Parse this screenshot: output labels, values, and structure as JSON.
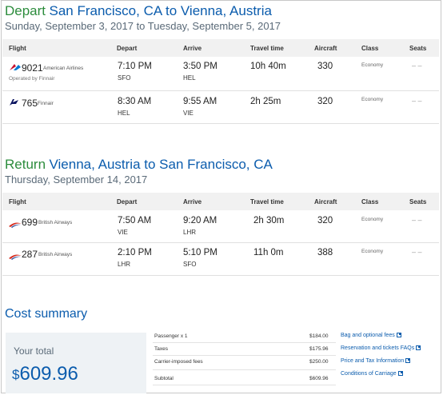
{
  "outbound": {
    "keyword": "Depart",
    "route": "San Francisco, CA to Vienna, Austria",
    "date_start": "Sunday, September 3, 2017",
    "date_mid": "to",
    "date_end": "Tuesday, September 5, 2017",
    "flights": [
      {
        "number": "9021",
        "carrier": "American Airlines",
        "operated_by": "Operated by Finnair",
        "depart_time": "7:10 PM",
        "depart_airport": "SFO",
        "arrive_time": "3:50 PM",
        "arrive_airport": "HEL",
        "travel_time": "10h 40m",
        "aircraft": "330",
        "class": "Economy",
        "seats": "– –",
        "logo_icon": "american-airlines-logo"
      },
      {
        "number": "765",
        "carrier": "Finnair",
        "operated_by": "",
        "depart_time": "8:30 AM",
        "depart_airport": "HEL",
        "arrive_time": "9:55 AM",
        "arrive_airport": "VIE",
        "travel_time": "2h 25m",
        "aircraft": "320",
        "class": "Economy",
        "seats": "– –",
        "logo_icon": "finnair-logo"
      }
    ]
  },
  "return": {
    "keyword": "Return",
    "route": "Vienna, Austria to San Francisco, CA",
    "date": "Thursday, September 14, 2017",
    "flights": [
      {
        "number": "699",
        "carrier": "British Airways",
        "depart_time": "7:50 AM",
        "depart_airport": "VIE",
        "arrive_time": "9:20 AM",
        "arrive_airport": "LHR",
        "travel_time": "2h 30m",
        "aircraft": "320",
        "class": "Economy",
        "seats": "– –",
        "logo_icon": "british-airways-logo"
      },
      {
        "number": "287",
        "carrier": "British Airways",
        "depart_time": "2:10 PM",
        "depart_airport": "LHR",
        "arrive_time": "5:10 PM",
        "arrive_airport": "SFO",
        "travel_time": "11h 0m",
        "aircraft": "388",
        "class": "Economy",
        "seats": "– –",
        "logo_icon": "british-airways-logo"
      }
    ]
  },
  "columns": {
    "flight": "Flight",
    "depart": "Depart",
    "arrive": "Arrive",
    "travel_time": "Travel time",
    "aircraft": "Aircraft",
    "class": "Class",
    "seats": "Seats"
  },
  "cost": {
    "title": "Cost summary",
    "total_label": "Your total",
    "currency": "$",
    "total": "609.96",
    "fees": [
      {
        "label": "Passenger x 1",
        "amount": "$184.00"
      },
      {
        "label": "Taxes",
        "amount": "$175.96"
      },
      {
        "label": "Carrier-imposed fees",
        "amount": "$250.00"
      },
      {
        "label": "Subtotal",
        "amount": "$609.96"
      }
    ],
    "links": [
      "Bag and optional fees",
      "Reservation and tickets FAQs",
      "Price and Tax Information",
      "Conditions of Carriage"
    ]
  },
  "colors": {
    "green": "#2c8c3c",
    "blue": "#0b5cad",
    "aa_red": "#c8102e",
    "finnair_blue": "#0b1560",
    "ba_red": "#d52b1e"
  }
}
